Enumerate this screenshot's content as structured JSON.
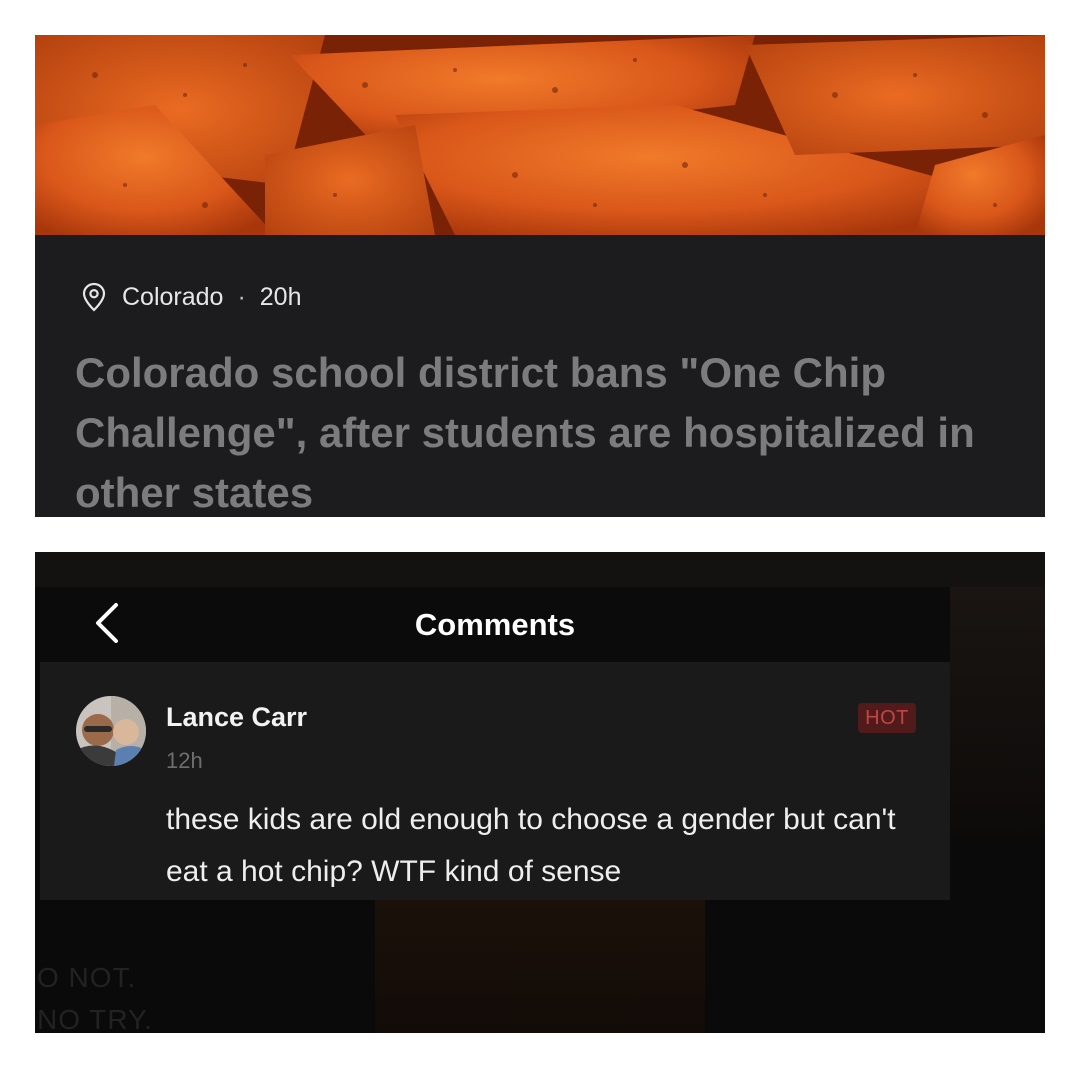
{
  "article": {
    "location": "Colorado",
    "separator": "·",
    "age": "20h",
    "headline": "Colorado school district bans \"One Chip Challenge\", after students are hospitalized in other states",
    "icons": {
      "location": "location-pin-icon"
    }
  },
  "comments_screen": {
    "title": "Comments",
    "icons": {
      "back": "chevron-left-icon"
    },
    "comment": {
      "author": "Lance Carr",
      "age": "12h",
      "badge": "HOT",
      "text": "these kids are old enough to choose a gender but can't eat a hot chip? WTF kind of sense"
    },
    "background_text": [
      "O NOT.",
      "NO TRY."
    ]
  },
  "colors": {
    "card_background": "#1c1c1e",
    "headline": "#7c7c7e",
    "hot_badge_bg": "#521b1b",
    "hot_badge_text": "#c24545"
  }
}
